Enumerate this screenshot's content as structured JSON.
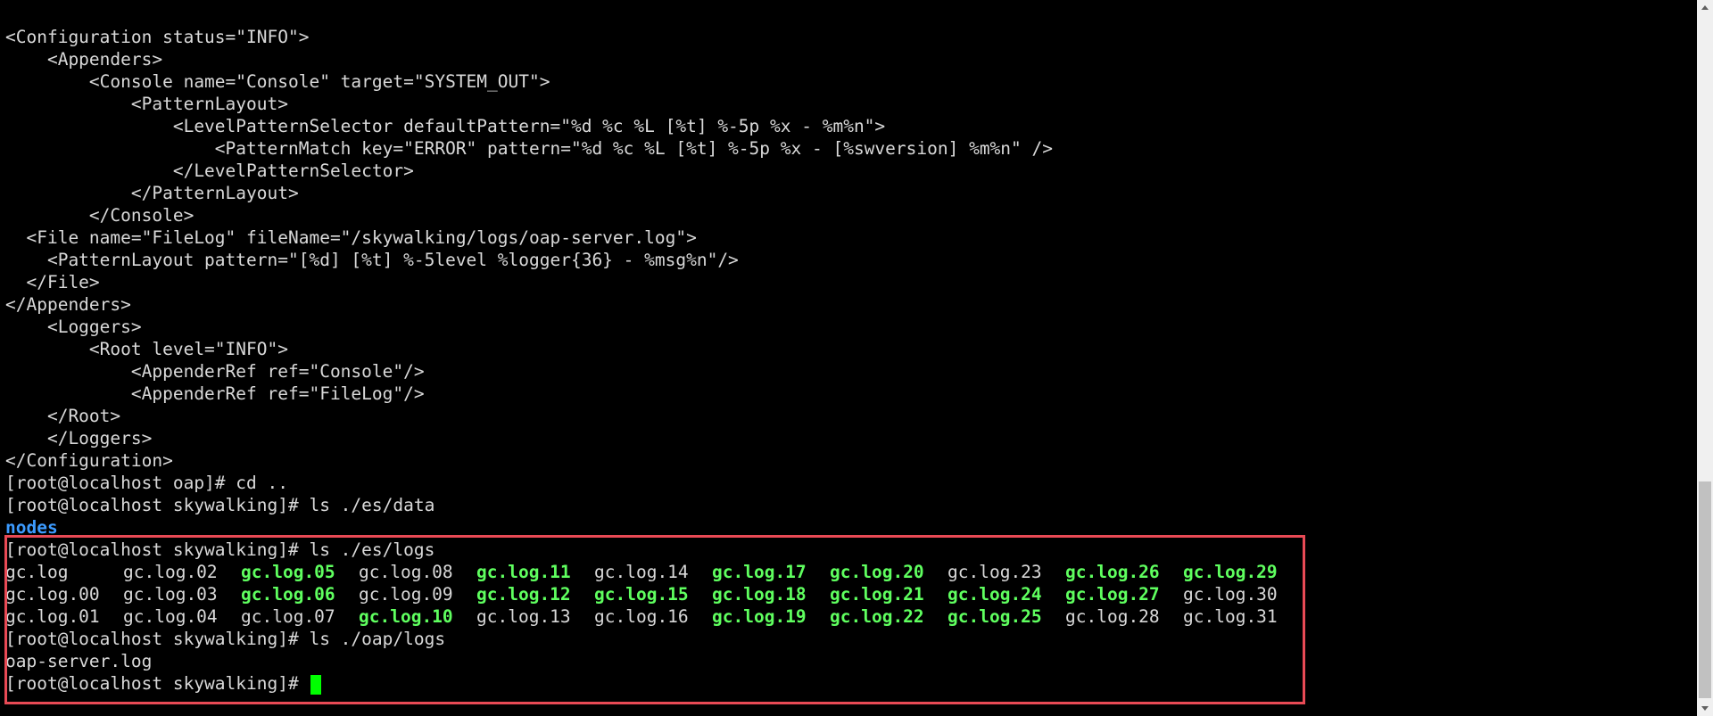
{
  "terminal": {
    "lines": [
      "<Configuration status=\"INFO\">",
      "    <Appenders>",
      "        <Console name=\"Console\" target=\"SYSTEM_OUT\">",
      "            <PatternLayout>",
      "                <LevelPatternSelector defaultPattern=\"%d %c %L [%t] %-5p %x - %m%n\">",
      "                    <PatternMatch key=\"ERROR\" pattern=\"%d %c %L [%t] %-5p %x - [%swversion] %m%n\" />",
      "                </LevelPatternSelector>",
      "            </PatternLayout>",
      "        </Console>",
      "  <File name=\"FileLog\" fileName=\"/skywalking/logs/oap-server.log\">",
      "    <PatternLayout pattern=\"[%d] [%t] %-5level %logger{36} - %msg%n\"/>",
      "  </File>",
      "</Appenders>",
      "    <Loggers>",
      "        <Root level=\"INFO\">",
      "            <AppenderRef ref=\"Console\"/>",
      "            <AppenderRef ref=\"FileLog\"/>",
      "    </Root>",
      "    </Loggers>",
      "</Configuration>",
      "[root@localhost oap]# cd ..",
      "[root@localhost skywalking]# ls ./es/data"
    ],
    "es_data_listing": "nodes",
    "cmd_ls_es_logs": "[root@localhost skywalking]# ls ./es/logs",
    "es_logs_files": [
      {
        "name": "gc.log",
        "executable": false
      },
      {
        "name": "gc.log.02",
        "executable": false
      },
      {
        "name": "gc.log.05",
        "executable": true
      },
      {
        "name": "gc.log.08",
        "executable": false
      },
      {
        "name": "gc.log.11",
        "executable": true
      },
      {
        "name": "gc.log.14",
        "executable": false
      },
      {
        "name": "gc.log.17",
        "executable": true
      },
      {
        "name": "gc.log.20",
        "executable": true
      },
      {
        "name": "gc.log.23",
        "executable": false
      },
      {
        "name": "gc.log.26",
        "executable": true
      },
      {
        "name": "gc.log.29",
        "executable": true
      },
      {
        "name": "gc.log.00",
        "executable": false
      },
      {
        "name": "gc.log.03",
        "executable": false
      },
      {
        "name": "gc.log.06",
        "executable": true
      },
      {
        "name": "gc.log.09",
        "executable": false
      },
      {
        "name": "gc.log.12",
        "executable": true
      },
      {
        "name": "gc.log.15",
        "executable": true
      },
      {
        "name": "gc.log.18",
        "executable": true
      },
      {
        "name": "gc.log.21",
        "executable": true
      },
      {
        "name": "gc.log.24",
        "executable": true
      },
      {
        "name": "gc.log.27",
        "executable": true
      },
      {
        "name": "gc.log.30",
        "executable": false
      },
      {
        "name": "gc.log.01",
        "executable": false
      },
      {
        "name": "gc.log.04",
        "executable": false
      },
      {
        "name": "gc.log.07",
        "executable": false
      },
      {
        "name": "gc.log.10",
        "executable": true
      },
      {
        "name": "gc.log.13",
        "executable": false
      },
      {
        "name": "gc.log.16",
        "executable": false
      },
      {
        "name": "gc.log.19",
        "executable": true
      },
      {
        "name": "gc.log.22",
        "executable": true
      },
      {
        "name": "gc.log.25",
        "executable": true
      },
      {
        "name": "gc.log.28",
        "executable": false
      },
      {
        "name": "gc.log.31",
        "executable": false
      }
    ],
    "cmd_ls_oap_logs": "[root@localhost skywalking]# ls ./oap/logs",
    "oap_logs_listing": "oap-server.log",
    "prompt": "[root@localhost skywalking]# "
  },
  "colors": {
    "background": "#000000",
    "text": "#d9d9d9",
    "directory": "#3c9bff",
    "executable": "#5fff5f",
    "cursor": "#00ff00",
    "highlight_border": "#e84a55"
  }
}
